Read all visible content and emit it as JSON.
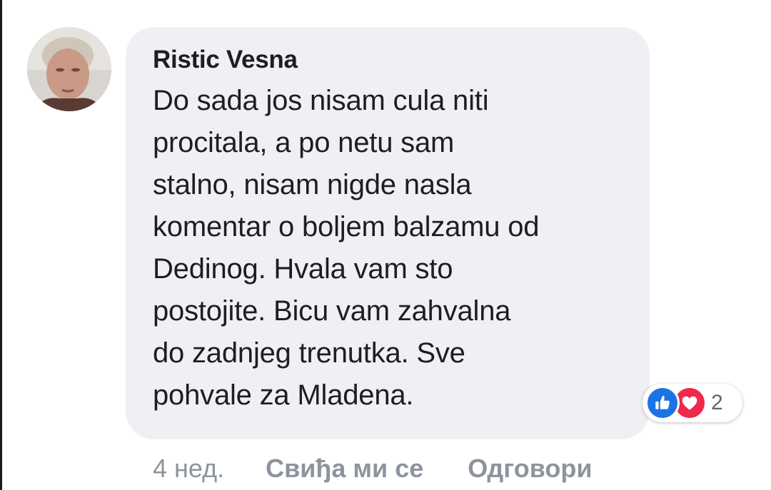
{
  "comment": {
    "author": "Ristic Vesna",
    "text": "Do sada jos nisam cula niti\nprocitala, a po netu sam\nstalno, nisam nigde nasla\nkomentar o boljem balzamu od\nDedinog. Hvala vam sto\npostojite. Bicu vam zahvalna\ndo zadnjeg trenutka. Sve\npohvale za Mladena."
  },
  "reactions": {
    "icons": [
      "like-icon",
      "love-icon"
    ],
    "count": "2"
  },
  "actions": {
    "timestamp": "4 нед.",
    "like_label": "Свиђа ми се",
    "reply_label": "Одговори"
  },
  "colors": {
    "bubble_bg": "#eff0f3",
    "like_blue": "#1b74e4",
    "love_red": "#f02849",
    "meta_gray": "#8d949e"
  }
}
